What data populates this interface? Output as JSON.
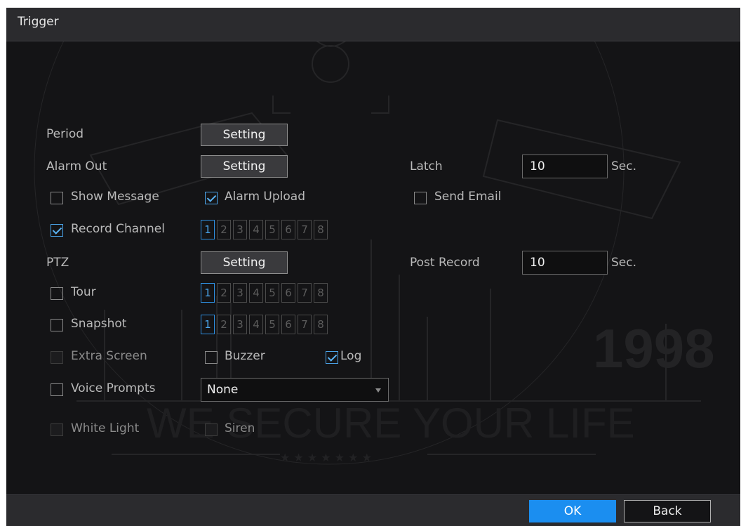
{
  "window": {
    "title": "Trigger"
  },
  "period": {
    "label": "Period",
    "button": "Setting"
  },
  "alarm_out": {
    "label": "Alarm Out",
    "button": "Setting"
  },
  "latch": {
    "label": "Latch",
    "value": "10",
    "unit": "Sec."
  },
  "show_message": {
    "label": "Show Message",
    "checked": false
  },
  "alarm_upload": {
    "label": "Alarm Upload",
    "checked": true
  },
  "send_email": {
    "label": "Send Email",
    "checked": false
  },
  "record_channel": {
    "label": "Record Channel",
    "checked": true,
    "channels": [
      "1",
      "2",
      "3",
      "4",
      "5",
      "6",
      "7",
      "8"
    ],
    "selected": [
      "1"
    ]
  },
  "ptz": {
    "label": "PTZ",
    "button": "Setting"
  },
  "post_record": {
    "label": "Post Record",
    "value": "10",
    "unit": "Sec."
  },
  "tour": {
    "label": "Tour",
    "checked": false,
    "channels": [
      "1",
      "2",
      "3",
      "4",
      "5",
      "6",
      "7",
      "8"
    ],
    "selected": [
      "1"
    ]
  },
  "snapshot": {
    "label": "Snapshot",
    "checked": false,
    "channels": [
      "1",
      "2",
      "3",
      "4",
      "5",
      "6",
      "7",
      "8"
    ],
    "selected": [
      "1"
    ]
  },
  "extra_screen": {
    "label": "Extra Screen",
    "enabled": false
  },
  "buzzer": {
    "label": "Buzzer",
    "checked": false
  },
  "log": {
    "label": "Log",
    "checked": true
  },
  "voice_prompts": {
    "label": "Voice Prompts",
    "checked": false,
    "selected": "None"
  },
  "white_light": {
    "label": "White Light",
    "enabled": false
  },
  "siren": {
    "label": "Siren",
    "enabled": false
  },
  "footer": {
    "ok": "OK",
    "back": "Back"
  },
  "watermark": {
    "lines": [
      "WE SECURE YOUR LIFE",
      "1998",
      "★ ★ ★ ★ ★ ★ ★"
    ]
  },
  "colors": {
    "accent": "#1b8ef0",
    "background": "#141416",
    "bar": "#2b2b2e"
  }
}
